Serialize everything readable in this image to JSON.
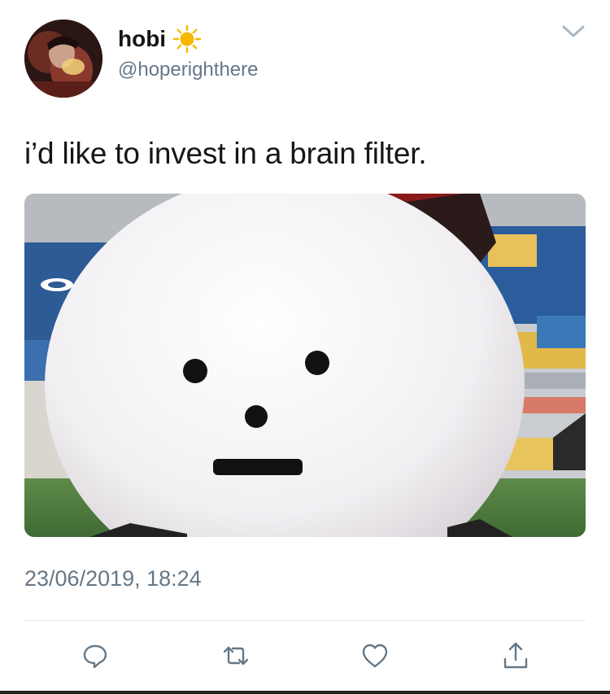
{
  "author": {
    "display_name": "hobi",
    "emoji_icon": "sun-icon",
    "handle": "@hoperighthere"
  },
  "tweet": {
    "text": "i’d like to invest in a brain filter.",
    "timestamp": "23/06/2019, 18:24"
  },
  "actions": [
    {
      "name": "reply",
      "icon": "reply-icon"
    },
    {
      "name": "retweet",
      "icon": "retweet-icon"
    },
    {
      "name": "like",
      "icon": "heart-icon"
    },
    {
      "name": "share",
      "icon": "share-icon"
    }
  ],
  "colors": {
    "text_primary": "#14171a",
    "text_secondary": "#657786",
    "divider": "#e1e8ed",
    "icon": "#657786",
    "sun": "#f5b800"
  }
}
